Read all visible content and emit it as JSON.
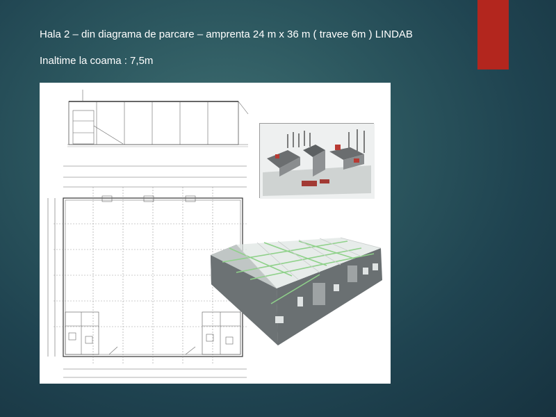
{
  "slide": {
    "title_line1": "Hala 2 –  din diagrama de parcare – amprenta 24 m x 36 m ( travee  6m ) LINDAB",
    "title_line2": "Inaltime la coama : 7,5m"
  },
  "colors": {
    "accent": "#b3261e",
    "text": "#ffffff",
    "background": "#2c575f"
  }
}
